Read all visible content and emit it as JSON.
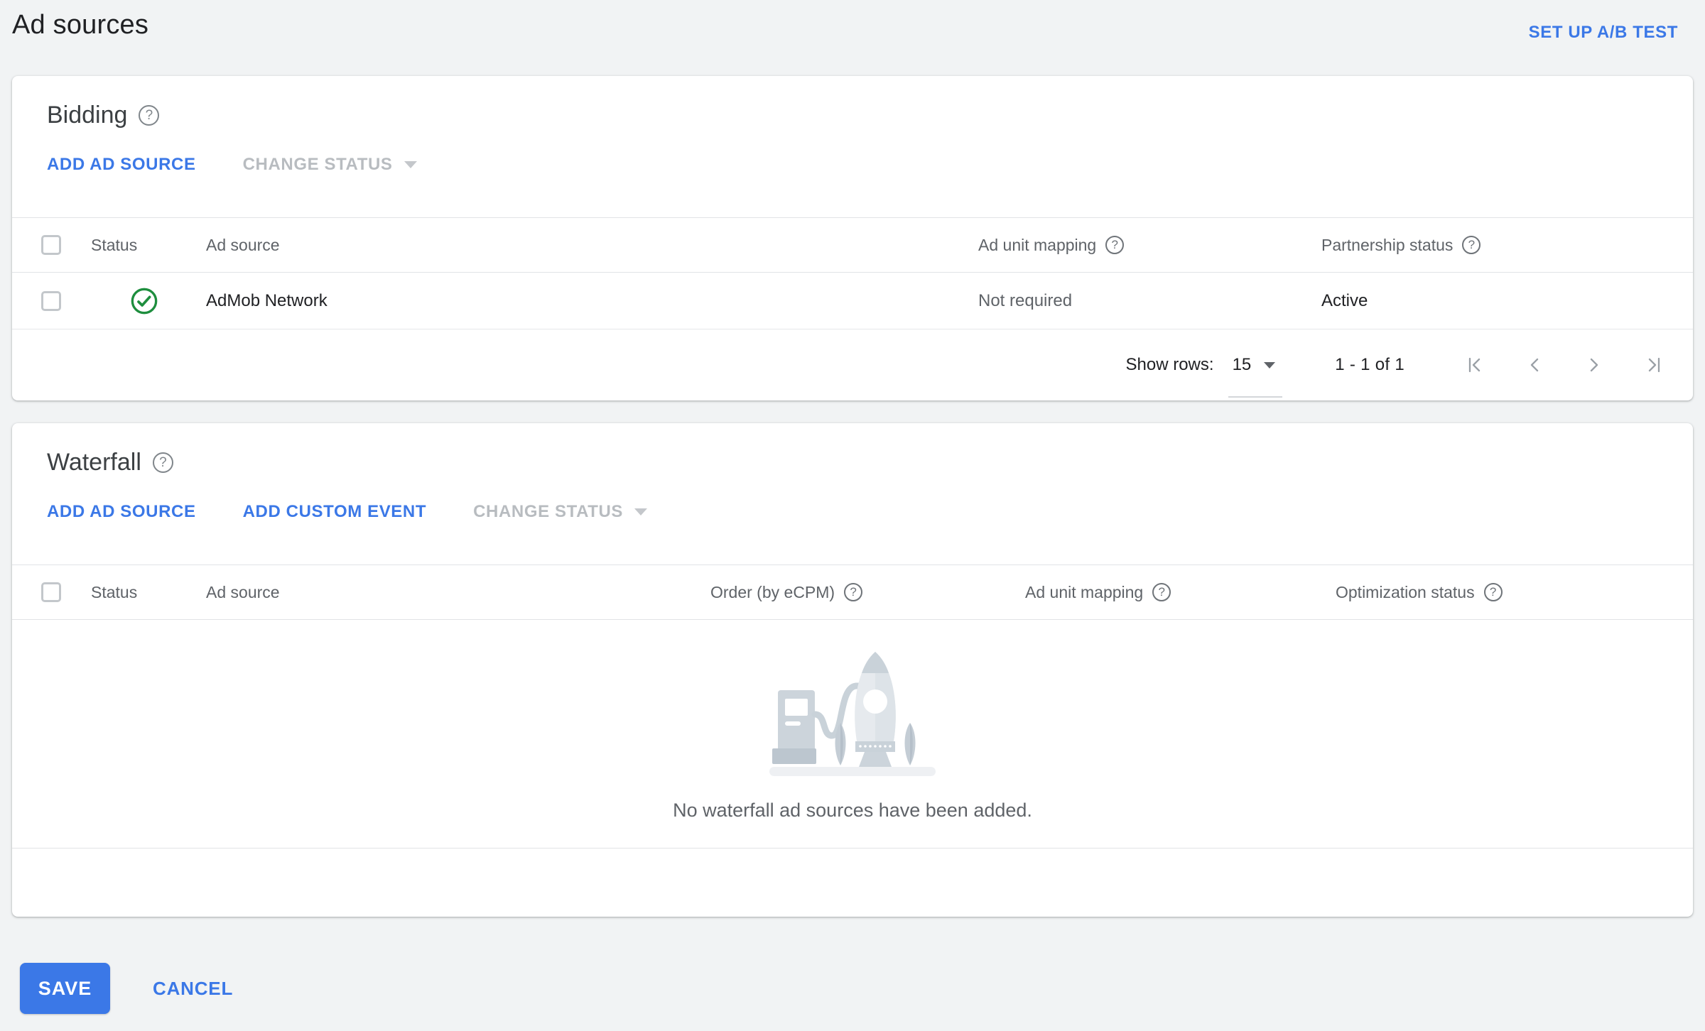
{
  "page": {
    "title": "Ad sources",
    "setup_ab_test": "SET UP A/B TEST"
  },
  "icons": {
    "help_glyph": "?"
  },
  "bidding": {
    "title": "Bidding",
    "add_ad_source": "ADD AD SOURCE",
    "change_status": "CHANGE STATUS",
    "headers": {
      "status": "Status",
      "ad_source": "Ad source",
      "ad_unit_mapping": "Ad unit mapping",
      "partnership_status": "Partnership status"
    },
    "rows": [
      {
        "status": "active",
        "ad_source": "AdMob Network",
        "ad_unit_mapping": "Not required",
        "partnership_status": "Active"
      }
    ],
    "pagination": {
      "show_rows": "Show rows:",
      "rows_per_page": "15",
      "range": "1 - 1 of 1"
    }
  },
  "waterfall": {
    "title": "Waterfall",
    "add_ad_source": "ADD AD SOURCE",
    "add_custom_event": "ADD CUSTOM EVENT",
    "change_status": "CHANGE STATUS",
    "headers": {
      "status": "Status",
      "ad_source": "Ad source",
      "order": "Order (by eCPM)",
      "ad_unit_mapping": "Ad unit mapping",
      "optimization_status": "Optimization status"
    },
    "empty_message": "No waterfall ad sources have been added."
  },
  "footer": {
    "save": "SAVE",
    "cancel": "CANCEL"
  },
  "colors": {
    "link_blue": "#3b78e7",
    "save_bg": "#3b78e7",
    "success_green": "#1e8e3e"
  }
}
